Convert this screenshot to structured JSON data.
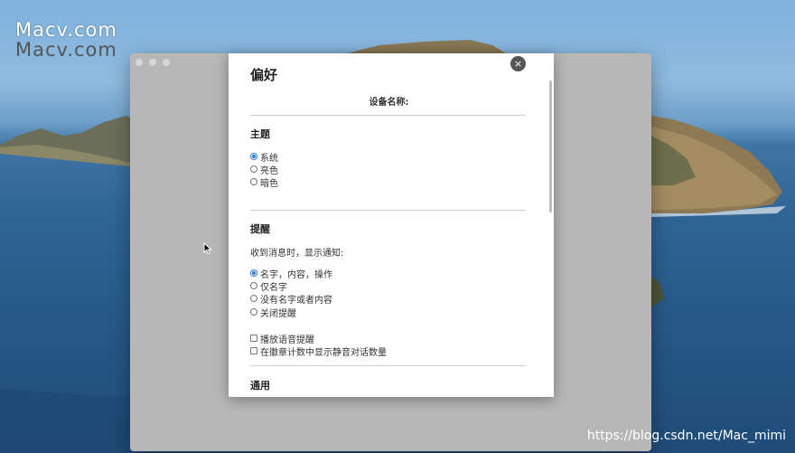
{
  "watermark": {
    "line1": "Macv.com",
    "line2": "Macv.com"
  },
  "credit": "https://blog.csdn.net/Mac_mimi",
  "dialog": {
    "title": "偏好",
    "close_symbol": "×",
    "device_label": "设备名称:",
    "theme": {
      "heading": "主题",
      "options": [
        {
          "label": "系统",
          "selected": true
        },
        {
          "label": "亮色",
          "selected": false
        },
        {
          "label": "暗色",
          "selected": false
        }
      ]
    },
    "notification": {
      "heading": "提醒",
      "description": "收到消息时，显示通知:",
      "options": [
        {
          "label": "名字，内容，操作",
          "selected": true
        },
        {
          "label": "仅名字",
          "selected": false
        },
        {
          "label": "没有名字或者内容",
          "selected": false
        },
        {
          "label": "关闭提醒",
          "selected": false
        }
      ],
      "checkboxes": [
        {
          "label": "播放语音提醒",
          "checked": false
        },
        {
          "label": "在徽章计数中显示静音对话数量",
          "checked": false
        }
      ]
    },
    "general": {
      "heading": "通用"
    }
  },
  "colors": {
    "accent": "#2f7be8",
    "backdrop": "#b7b7b7"
  }
}
